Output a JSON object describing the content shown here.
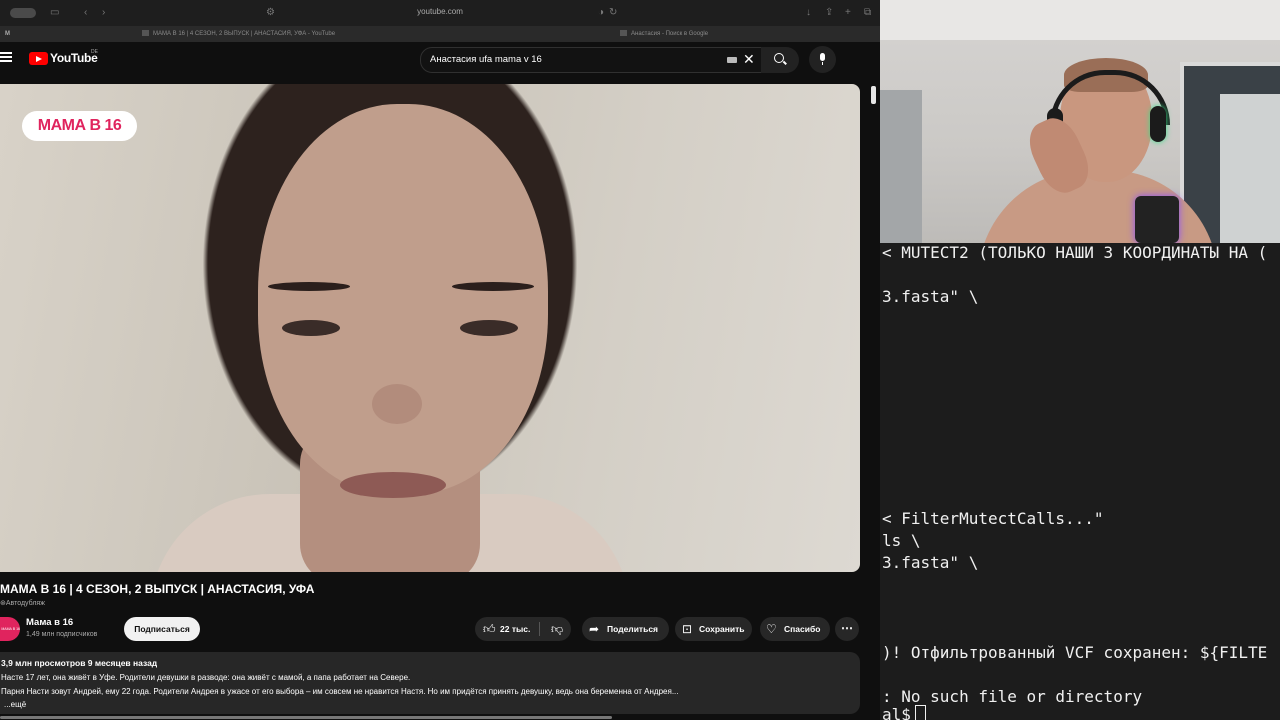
{
  "browser": {
    "url": "youtube.com",
    "tabs": [
      {
        "label": "МАМА В 16 | 4 СЕЗОН, 2 ВЫПУСК | АНАСТАСИЯ, УФА - YouTube"
      },
      {
        "label": "Анастасия - Поиск в Google"
      }
    ]
  },
  "header": {
    "logo_text": "YouTube",
    "region": "DE",
    "search_value": "Анастасия ufa mama v 16"
  },
  "video": {
    "badge": "МАМА В 16",
    "title": "МАМА В 16 | 4 СЕЗОН, 2 ВЫПУСК | АНАСТАСИЯ, УФА",
    "dub_label": "Автодубляж"
  },
  "channel": {
    "name": "Мама в 16",
    "subscribers": "1,49 млн подписчиков",
    "avatar_text": "МАМА В 16",
    "subscribe_label": "Подписаться"
  },
  "actions": {
    "likes": "22 тыс.",
    "share": "Поделиться",
    "save": "Сохранить",
    "thanks": "Спасибо"
  },
  "description": {
    "meta": "3,9 млн просмотров  9 месяцев назад",
    "line1": "Насте 17 лет, она живёт в Уфе. Родители девушки в разводе: она живёт с мамой, а папа работает на Севере.",
    "line2": "Парня Насти зовут Андрей, ему 22 года. Родители Андрея в ужасе от его выбора – им совсем не нравится Настя. Но им придётся принять девушку, ведь она беременна от Андрея...",
    "more": "...ещё"
  },
  "terminal": {
    "lines": [
      "< MUTECT2 (ТОЛЬКО НАШИ 3 КООРДИНАТЫ НА (",
      "3.fasta\" \\",
      "< FilterMutectCalls...\"",
      "ls \\",
      "3.fasta\" \\",
      ")! Отфильтрованный VCF сохранен: ${FILTE",
      ": No such file or directory",
      "al$"
    ]
  },
  "colors": {
    "yt_red": "#ff0000",
    "yt_bg": "#0f0f0f",
    "badge_pink": "#e0245e",
    "terminal_bg": "#1c1c1c"
  }
}
